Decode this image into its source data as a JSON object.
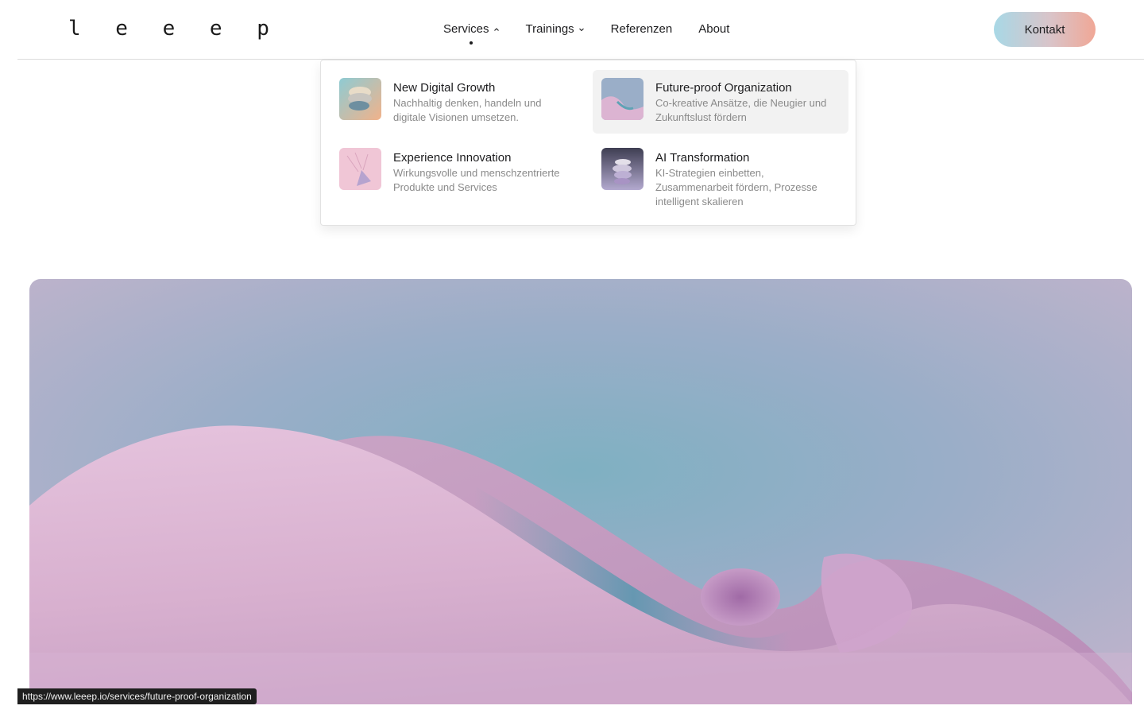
{
  "header": {
    "logo": "l e e e p",
    "nav": [
      {
        "label": "Services",
        "has_dropdown": true,
        "open": true
      },
      {
        "label": "Trainings",
        "has_dropdown": true,
        "open": false
      },
      {
        "label": "Referenzen"
      },
      {
        "label": "About"
      }
    ],
    "cta_label": "Kontakt"
  },
  "services_menu": [
    {
      "title": "New Digital Growth",
      "description": "Nachhaltig denken, handeln und digitale Visionen umsetzen.",
      "thumb_icon": "stacked-discs-image"
    },
    {
      "title": "Future-proof Organization",
      "description": "Co-kreative Ansätze, die Neugier und Zukunftslust fördern",
      "thumb_icon": "wave-image",
      "hovered": true
    },
    {
      "title": "Experience Innovation",
      "description": "Wirkungsvolle und menschzentrierte Produkte und Services",
      "thumb_icon": "prism-image"
    },
    {
      "title": "AI Transformation",
      "description": "KI-Strategien einbetten, Zusammenarbeit fördern, Prozesse intelligent skalieren",
      "thumb_icon": "stacked-shapes-image"
    }
  ],
  "status_bar": {
    "url": "https://www.leeep.io/services/future-proof-organization"
  },
  "colors": {
    "cta_gradient_start": "#a8d8e6",
    "cta_gradient_end": "#f0a796",
    "hero_sky": "#9aaec8",
    "hero_wave": "#dcb4d2",
    "hero_teal": "#5fa3b5"
  }
}
